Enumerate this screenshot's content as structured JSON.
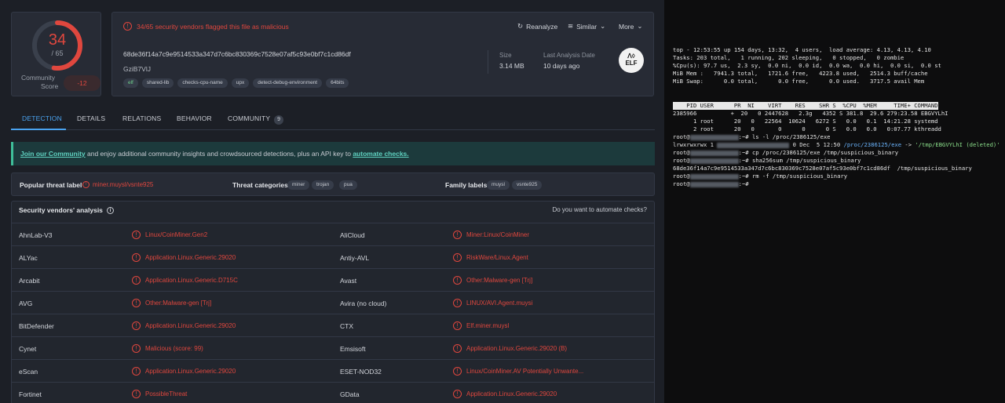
{
  "score": {
    "value": "34",
    "total": "/ 65",
    "label_line1": "Community",
    "label_line2": "Score",
    "community_value": "-12"
  },
  "alert": "34/65 security vendors flagged this file as malicious",
  "actions": {
    "reanalyze": "Reanalyze",
    "similar": "Similar",
    "more": "More"
  },
  "file": {
    "hash": "68de36f14a7c9e9514533a347d7c6bc830369c7528e07af5c93e0bf7c1cd86df",
    "name": "GziB7VlJ",
    "tags": [
      "elf",
      "shared-lib",
      "checks-cpu-name",
      "upx",
      "detect-debug-environment",
      "64bits"
    ],
    "size_label": "Size",
    "size_value": "3.14 MB",
    "analysis_label": "Last Analysis Date",
    "analysis_value": "10 days ago",
    "type_badge": "ELF"
  },
  "tabs": [
    {
      "label": "DETECTION"
    },
    {
      "label": "DETAILS"
    },
    {
      "label": "RELATIONS"
    },
    {
      "label": "BEHAVIOR"
    },
    {
      "label": "COMMUNITY",
      "count": "9"
    }
  ],
  "banner": {
    "link1": "Join our Community",
    "mid": " and enjoy additional community insights and crowdsourced detections, plus an API key to ",
    "link2": "automate checks."
  },
  "threat": {
    "popular_label": "Popular threat label",
    "popular_value": "miner.muysl/vsnte925",
    "cat_label": "Threat categories",
    "categories": [
      "miner",
      "trojan",
      "pua"
    ],
    "family_label": "Family labels",
    "families": [
      "muysl",
      "vsnte925"
    ]
  },
  "vendors": {
    "title": "Security vendors' analysis",
    "automate": "Do you want to automate checks?",
    "rows": [
      {
        "v1": "AhnLab-V3",
        "r1": "Linux/CoinMiner.Gen2",
        "v2": "AliCloud",
        "r2": "Miner:Linux/CoinMiner"
      },
      {
        "v1": "ALYac",
        "r1": "Application.Linux.Generic.29020",
        "v2": "Antiy-AVL",
        "r2": "RiskWare/Linux.Agent"
      },
      {
        "v1": "Arcabit",
        "r1": "Application.Linux.Generic.D715C",
        "v2": "Avast",
        "r2": "Other:Malware-gen [Trj]"
      },
      {
        "v1": "AVG",
        "r1": "Other:Malware-gen [Trj]",
        "v2": "Avira (no cloud)",
        "r2": "LINUX/AVI.Agent.muysi"
      },
      {
        "v1": "BitDefender",
        "r1": "Application.Linux.Generic.29020",
        "v2": "CTX",
        "r2": "Elf.miner.muysl"
      },
      {
        "v1": "Cynet",
        "r1": "Malicious (score: 99)",
        "v2": "Emsisoft",
        "r2": "Application.Linux.Generic.29020 (B)"
      },
      {
        "v1": "eScan",
        "r1": "Application.Linux.Generic.29020",
        "v2": "ESET-NOD32",
        "r2": "Linux/CoinMiner.AV Potentially Unwante..."
      },
      {
        "v1": "Fortinet",
        "r1": "PossibleThreat",
        "v2": "GData",
        "r2": "Application.Linux.Generic.29020"
      }
    ]
  },
  "terminal": {
    "top": [
      "top - 12:53:55 up 154 days, 13:32,  4 users,  load average: 4.13, 4.13, 4.10",
      "Tasks: 203 total,   1 running, 202 sleeping,   0 stopped,   0 zombie",
      "%Cpu(s): 97.7 us,  2.3 sy,  0.0 ni,  0.0 id,  0.0 wa,  0.0 hi,  0.0 si,  0.0 st",
      "MiB Mem :   7941.3 total,   1721.6 free,   4223.8 used,   2514.3 buff/cache",
      "MiB Swap:      0.0 total,      0.0 free,      0.0 used.   3717.5 avail Mem"
    ],
    "header": "    PID USER      PR  NI    VIRT    RES    SHR S  %CPU  %MEM     TIME+ COMMAND",
    "procs": [
      "2385966          +  20   0 2447628   2.3g   4352 S 381.8  29.6 279:23.58 EBGVYLhI",
      "      1 root      20   0   22564  10624   6272 S   0.0   0.1  14:21.28 systemd",
      "      2 root      20   0       0      0      0 S   0.0   0.0   0:07.77 kthreadd"
    ],
    "cmd1": ":~# ls -l /proc/2386125/exe",
    "ls_a": "lrwxrwxrwx 1 ",
    "ls_b": " 0 Dec  5 12:50 ",
    "ls_path": "/proc/2386125/exe",
    "ls_arrow": " -> ",
    "ls_target": "'/tmp/EBGVYLhI (deleted)'",
    "cmd2": ":~# cp /proc/2386125/exe /tmp/suspicious_binary",
    "cmd3": ":~# sha256sum /tmp/suspicious_binary",
    "sha": "68de36f14a7c9e9514533a347d7c6bc830369c7528e07af5c93e0bf7c1cd86df  /tmp/suspicious_binary",
    "cmd4": ":~# rm -f /tmp/suspicious_binary",
    "cmd5": ":~#",
    "prompt": "root@"
  }
}
